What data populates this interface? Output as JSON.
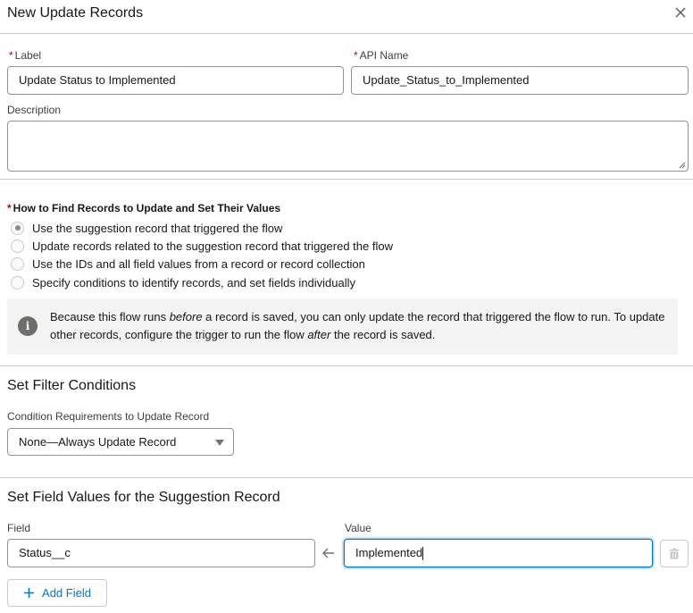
{
  "header": {
    "title": "New Update Records",
    "close_icon": "close-icon"
  },
  "fields": {
    "label": {
      "label": "Label",
      "required_marker": "*",
      "value": "Update Status to Implemented"
    },
    "api_name": {
      "label": "API Name",
      "required_marker": "*",
      "value": "Update_Status_to_Implemented"
    },
    "description": {
      "label": "Description",
      "value": ""
    }
  },
  "how_to_find": {
    "legend": "How to Find Records to Update and Set Their Values",
    "required_marker": "*",
    "options": [
      {
        "label": "Use the suggestion record that triggered the flow",
        "selected": true
      },
      {
        "label": "Update records related to the suggestion record that triggered the flow",
        "selected": false
      },
      {
        "label": "Use the IDs and all field values from a record or record collection",
        "selected": false
      },
      {
        "label": "Specify conditions to identify records, and set fields individually",
        "selected": false
      }
    ]
  },
  "info": {
    "icon": "info-icon",
    "text_part1": "Because this flow runs ",
    "text_em1": "before",
    "text_part2": " a record is saved, you can only update the record that triggered the flow to run. To update other records, configure the trigger to run the flow ",
    "text_em2": "after",
    "text_part3": " the record is saved."
  },
  "filter": {
    "heading": "Set Filter Conditions",
    "condition_label": "Condition Requirements to Update Record",
    "condition_value": "None—Always Update Record"
  },
  "field_values": {
    "heading": "Set Field Values for the Suggestion Record",
    "field_label": "Field",
    "value_label": "Value",
    "rows": [
      {
        "field": "Status__c",
        "value": "Implemented"
      }
    ],
    "add_field_label": "Add Field"
  }
}
